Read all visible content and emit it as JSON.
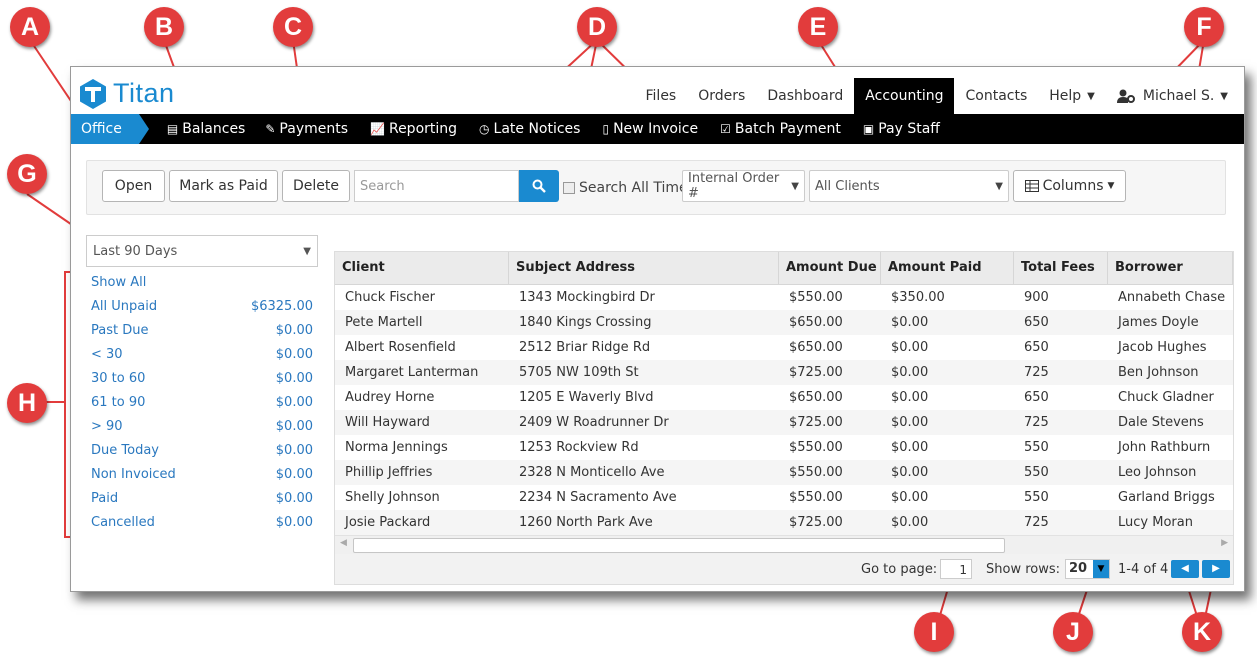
{
  "app": {
    "name": "Titan"
  },
  "topnav": {
    "files": "Files",
    "orders": "Orders",
    "dashboard": "Dashboard",
    "accounting": "Accounting",
    "contacts": "Contacts",
    "help": "Help",
    "user": "Michael S."
  },
  "subnav": {
    "office": "Office",
    "balances": "Balances",
    "payments": "Payments",
    "reporting": "Reporting",
    "late_notices": "Late Notices",
    "new_invoice": "New Invoice",
    "batch_payment": "Batch Payment",
    "pay_staff": "Pay Staff"
  },
  "toolbar": {
    "open": "Open",
    "mark_paid": "Mark as Paid",
    "delete": "Delete",
    "search_placeholder": "Search",
    "search_all_time": "Search All Time",
    "order_field": "Internal Order #",
    "clients": "All Clients",
    "columns": "Columns"
  },
  "date_range": "Last 90 Days",
  "filters": [
    {
      "label": "Show All",
      "amount": ""
    },
    {
      "label": "All Unpaid",
      "amount": "$6325.00"
    },
    {
      "label": "Past Due",
      "amount": "$0.00"
    },
    {
      "label": "< 30",
      "amount": "$0.00"
    },
    {
      "label": "30 to 60",
      "amount": "$0.00"
    },
    {
      "label": "61 to 90",
      "amount": "$0.00"
    },
    {
      "label": "> 90",
      "amount": "$0.00"
    },
    {
      "label": "Due Today",
      "amount": "$0.00"
    },
    {
      "label": "Non Invoiced",
      "amount": "$0.00"
    },
    {
      "label": "Paid",
      "amount": "$0.00"
    },
    {
      "label": "Cancelled",
      "amount": "$0.00"
    }
  ],
  "table": {
    "columns": [
      "Client",
      "Subject Address",
      "Amount Due",
      "Amount Paid",
      "Total Fees",
      "Borrower"
    ],
    "rows": [
      [
        "Chuck Fischer",
        "1343 Mockingbird Dr",
        "$550.00",
        "$350.00",
        "900",
        "Annabeth Chase"
      ],
      [
        "Pete Martell",
        "1840 Kings Crossing",
        "$650.00",
        "$0.00",
        "650",
        "James Doyle"
      ],
      [
        "Albert Rosenfield",
        "2512 Briar Ridge Rd",
        "$650.00",
        "$0.00",
        "650",
        "Jacob Hughes"
      ],
      [
        "Margaret Lanterman",
        "5705 NW 109th St",
        "$725.00",
        "$0.00",
        "725",
        "Ben Johnson"
      ],
      [
        "Audrey Horne",
        "1205 E Waverly Blvd",
        "$650.00",
        "$0.00",
        "650",
        "Chuck Gladner"
      ],
      [
        "Will Hayward",
        "2409 W Roadrunner Dr",
        "$725.00",
        "$0.00",
        "725",
        "Dale Stevens"
      ],
      [
        "Norma Jennings",
        "1253 Rockview Rd",
        "$550.00",
        "$0.00",
        "550",
        "John Rathburn"
      ],
      [
        "Phillip Jeffries",
        "2328 N Monticello Ave",
        "$550.00",
        "$0.00",
        "550",
        "Leo Johnson"
      ],
      [
        "Shelly Johnson",
        "2234 N Sacramento Ave",
        "$550.00",
        "$0.00",
        "550",
        "Garland Briggs"
      ],
      [
        "Josie Packard",
        "1260 North Park Ave",
        "$725.00",
        "$0.00",
        "725",
        "Lucy Moran"
      ]
    ]
  },
  "pager": {
    "goto_label": "Go to page:",
    "page": "1",
    "rows_label": "Show rows:",
    "rows": "20",
    "range": "1-4 of 4"
  },
  "callouts": [
    "A",
    "B",
    "C",
    "D",
    "E",
    "F",
    "G",
    "H",
    "I",
    "J",
    "K"
  ],
  "colors": {
    "accent": "#1a8ad0",
    "callout": "#e23c3c",
    "link": "#2a78bf"
  }
}
